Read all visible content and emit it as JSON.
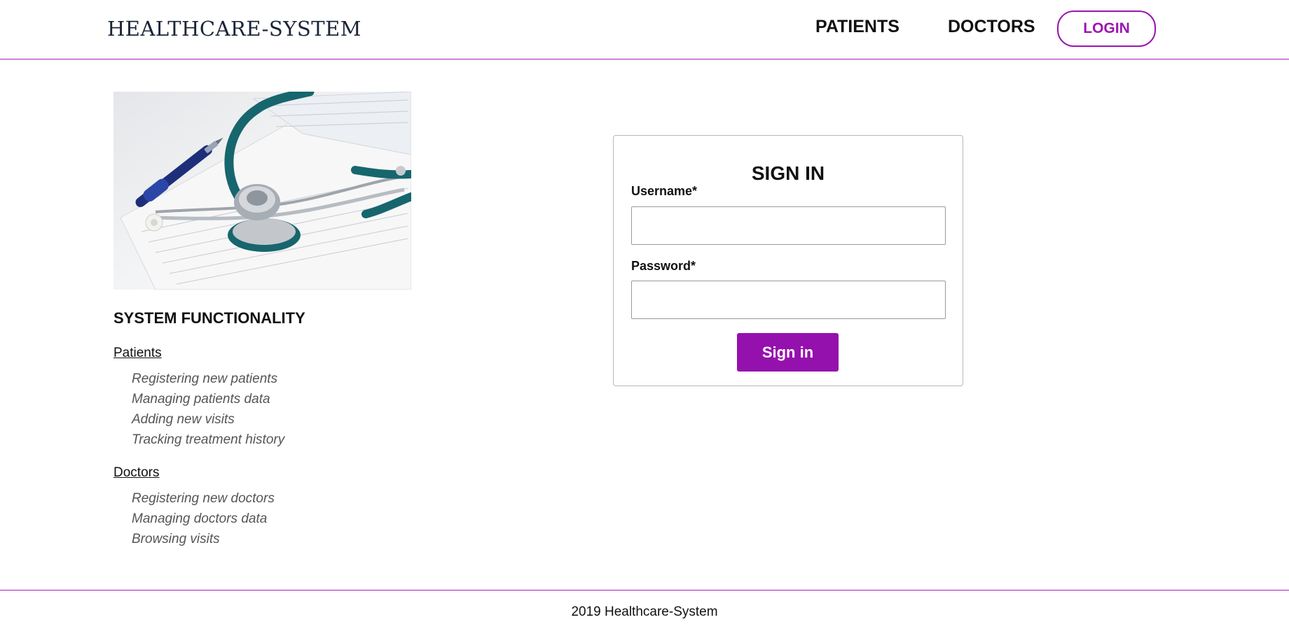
{
  "header": {
    "logo": "HEALTHCARE-SYSTEM",
    "nav": {
      "patients": "PATIENTS",
      "doctors": "DOCTORS"
    },
    "login_label": "LOGIN",
    "accent_color": "#9a16b0"
  },
  "functionality": {
    "title": "SYSTEM FUNCTIONALITY",
    "patients": {
      "label": "Patients",
      "items": [
        "Registering new patients",
        "Managing patients data",
        "Adding new visits",
        "Tracking treatment history"
      ]
    },
    "doctors": {
      "label": "Doctors",
      "items": [
        "Registering new doctors",
        "Managing doctors data",
        "Browsing visits"
      ]
    }
  },
  "signin": {
    "title": "SIGN IN",
    "username_label": "Username*",
    "username_value": "",
    "password_label": "Password*",
    "password_value": "",
    "button_label": "Sign in",
    "button_color": "#9511ad"
  },
  "footer": {
    "text": "2019 Healthcare-System"
  },
  "icons": {
    "hero_image": "stethoscope-image"
  }
}
